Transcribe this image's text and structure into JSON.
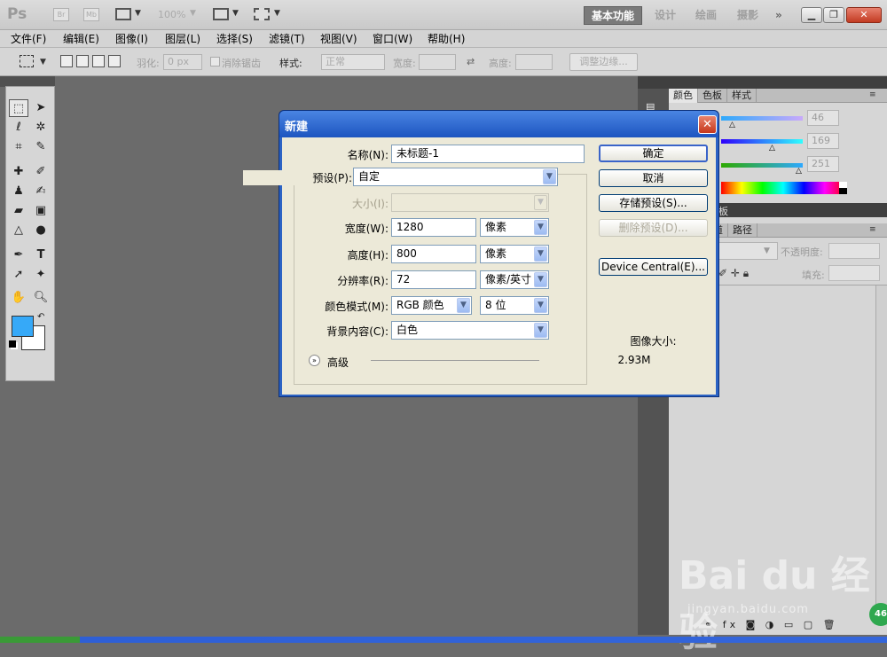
{
  "app": {
    "logo": "Ps",
    "bridge": "Br",
    "minibridge": "Mb",
    "zoom": "100%",
    "workspaces": [
      "基本功能",
      "设计",
      "绘画",
      "摄影",
      "»"
    ]
  },
  "menu": [
    "文件(F)",
    "编辑(E)",
    "图像(I)",
    "图层(L)",
    "选择(S)",
    "滤镜(T)",
    "视图(V)",
    "窗口(W)",
    "帮助(H)"
  ],
  "options": {
    "feather_label": "羽化:",
    "feather_value": "0 px",
    "antialias_label": "消除锯齿",
    "style_label": "样式:",
    "style_value": "正常",
    "width_label": "宽度:",
    "height_label": "高度:",
    "refine_edge": "调整边缘..."
  },
  "colors": {
    "foreground": "#36a9f8",
    "background": "#ffffff"
  },
  "right_panel": {
    "tabs": [
      "颜色",
      "色板",
      "样式"
    ],
    "rgb_values": [
      "46",
      "169",
      "251"
    ],
    "layers_tabs_partial": "板",
    "layers_tabs": [
      "道",
      "路径"
    ],
    "opacity_label": "不透明度:",
    "fill_label": "填充:"
  },
  "dialog": {
    "title": "新建",
    "name_label": "名称(N):",
    "name_value": "未标题-1",
    "preset_label": "预设(P):",
    "preset_value": "自定",
    "size_label": "大小(I):",
    "width_label": "宽度(W):",
    "width_value": "1280",
    "width_unit": "像素",
    "height_label": "高度(H):",
    "height_value": "800",
    "height_unit": "像素",
    "resolution_label": "分辨率(R):",
    "resolution_value": "72",
    "resolution_unit": "像素/英寸",
    "color_mode_label": "颜色模式(M):",
    "color_mode_value": "RGB 颜色",
    "bit_depth": "8 位",
    "background_label": "背景内容(C):",
    "background_value": "白色",
    "advanced_label": "高级",
    "ok": "确定",
    "cancel": "取消",
    "save_preset": "存储预设(S)...",
    "delete_preset": "删除预设(D)...",
    "device_central": "Device Central(E)...",
    "image_size_label": "图像大小:",
    "image_size_value": "2.93M"
  },
  "watermark": {
    "brand": "Bai du 经验",
    "url": "jingyan.baidu.com",
    "badge": "46"
  }
}
